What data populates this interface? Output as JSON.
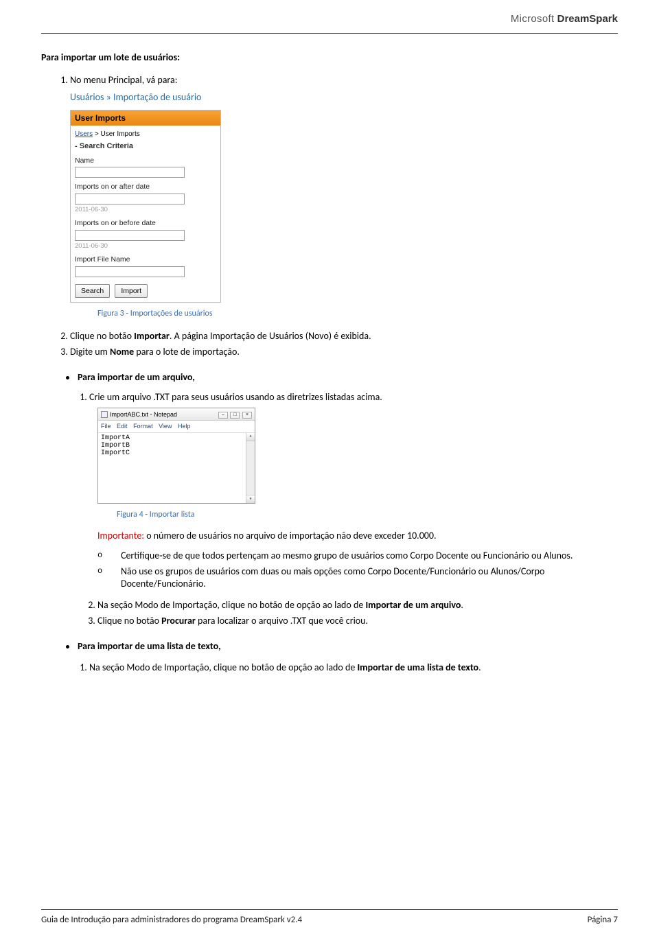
{
  "brand": {
    "part1": "Microsoft",
    "part2": "DreamSpark"
  },
  "section": {
    "title": "Para importar um lote de usuários:",
    "step1": "No menu Principal, vá para:",
    "link_path": "Usuários » Importação de usuário"
  },
  "ui_box": {
    "window_title": "User Imports",
    "breadcrumb_users": "Users",
    "breadcrumb_sep": " > ",
    "breadcrumb_current": "User Imports",
    "search_heading": "Search Criteria",
    "label_name": "Name",
    "label_after": "Imports on or after date",
    "date_hint1": "2011-06-30",
    "label_before": "Imports on or before date",
    "date_hint2": "2011-06-30",
    "label_filename": "Import File Name",
    "btn_search": "Search",
    "btn_import": "Import"
  },
  "fig3": "Figura 3 - Importações de usuários",
  "step2": "Clique no botão Importar. A página Importação de Usuários (Novo) é exibida.",
  "step2_bold": "Importar",
  "step3_pre": "Digite um ",
  "step3_bold": "Nome",
  "step3_post": " para o lote de importação.",
  "bullet_file": "Para importar de um arquivo,",
  "crie_step": "Crie um arquivo .TXT para seus usuários usando as diretrizes listadas acima.",
  "notepad": {
    "title": "ImportABC.txt - Notepad",
    "menu": [
      "File",
      "Edit",
      "Format",
      "View",
      "Help"
    ],
    "lines": [
      "ImportA",
      "ImportB",
      "ImportC"
    ]
  },
  "fig4": "Figura 4 - Importar lista",
  "importante_label": "Importante:",
  "importante_text": " o número de usuários no arquivo de importação não deve exceder 10.000.",
  "sub_o": [
    "Certifique-se de que todos pertençam ao mesmo grupo de usuários como Corpo Docente ou Funcionário ou Alunos.",
    "Não use os grupos de usuários com duas ou mais opções como Corpo Docente/Funcionário ou Alunos/Corpo Docente/Funcionário."
  ],
  "steps_after": {
    "s2_pre": "Na seção Modo de Importação, clique no botão de opção ao lado de ",
    "s2_bold": "Importar de um arquivo",
    "s2_post": ".",
    "s3_pre": "Clique no botão ",
    "s3_bold": "Procurar",
    "s3_post": " para localizar o arquivo .TXT que você criou."
  },
  "bullet_textlist": "Para importar de uma lista de texto,",
  "final_step_pre": "Na seção Modo de Importação, clique no botão de opção ao lado de ",
  "final_step_bold": "Importar de uma lista de texto",
  "final_step_post": ".",
  "footer": {
    "left": "Guia de Introdução para administradores do programa DreamSpark v2.4",
    "right": "Página 7"
  }
}
